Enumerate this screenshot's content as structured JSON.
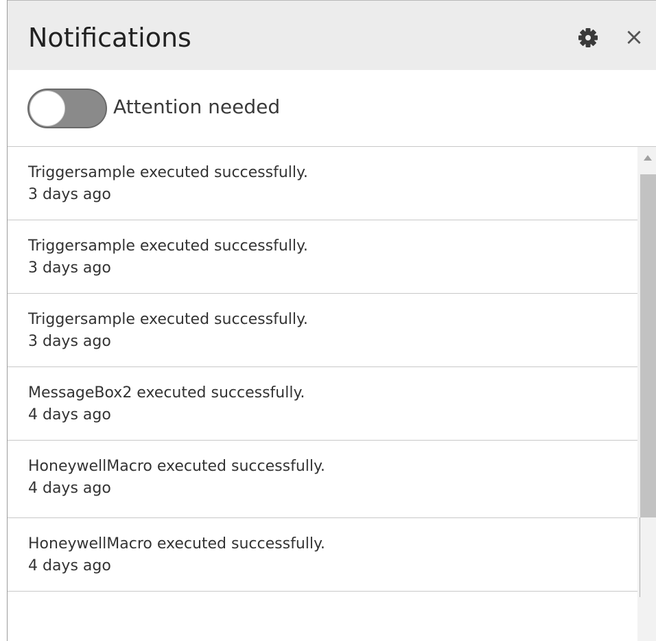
{
  "header": {
    "title": "Notifications",
    "settings_icon": "gear-icon",
    "close_icon": "close-icon",
    "close_glyph": "×"
  },
  "filter": {
    "toggle_label": "Attention needed",
    "toggle_on": false
  },
  "notifications": [
    {
      "message": "Triggersample executed successfully.",
      "time": "3 days ago"
    },
    {
      "message": "Triggersample executed successfully.",
      "time": "3 days ago"
    },
    {
      "message": "Triggersample executed successfully.",
      "time": "3 days ago"
    },
    {
      "message": "MessageBox2 executed successfully.",
      "time": "4 days ago"
    },
    {
      "message": "HoneywellMacro executed successfully.",
      "time": "4 days ago"
    },
    {
      "message": "HoneywellMacro executed successfully.",
      "time": "4 days ago"
    }
  ],
  "colors": {
    "header_bg": "#ececec",
    "toggle_track": "#8a8a8a",
    "divider": "#c8c8c8"
  }
}
